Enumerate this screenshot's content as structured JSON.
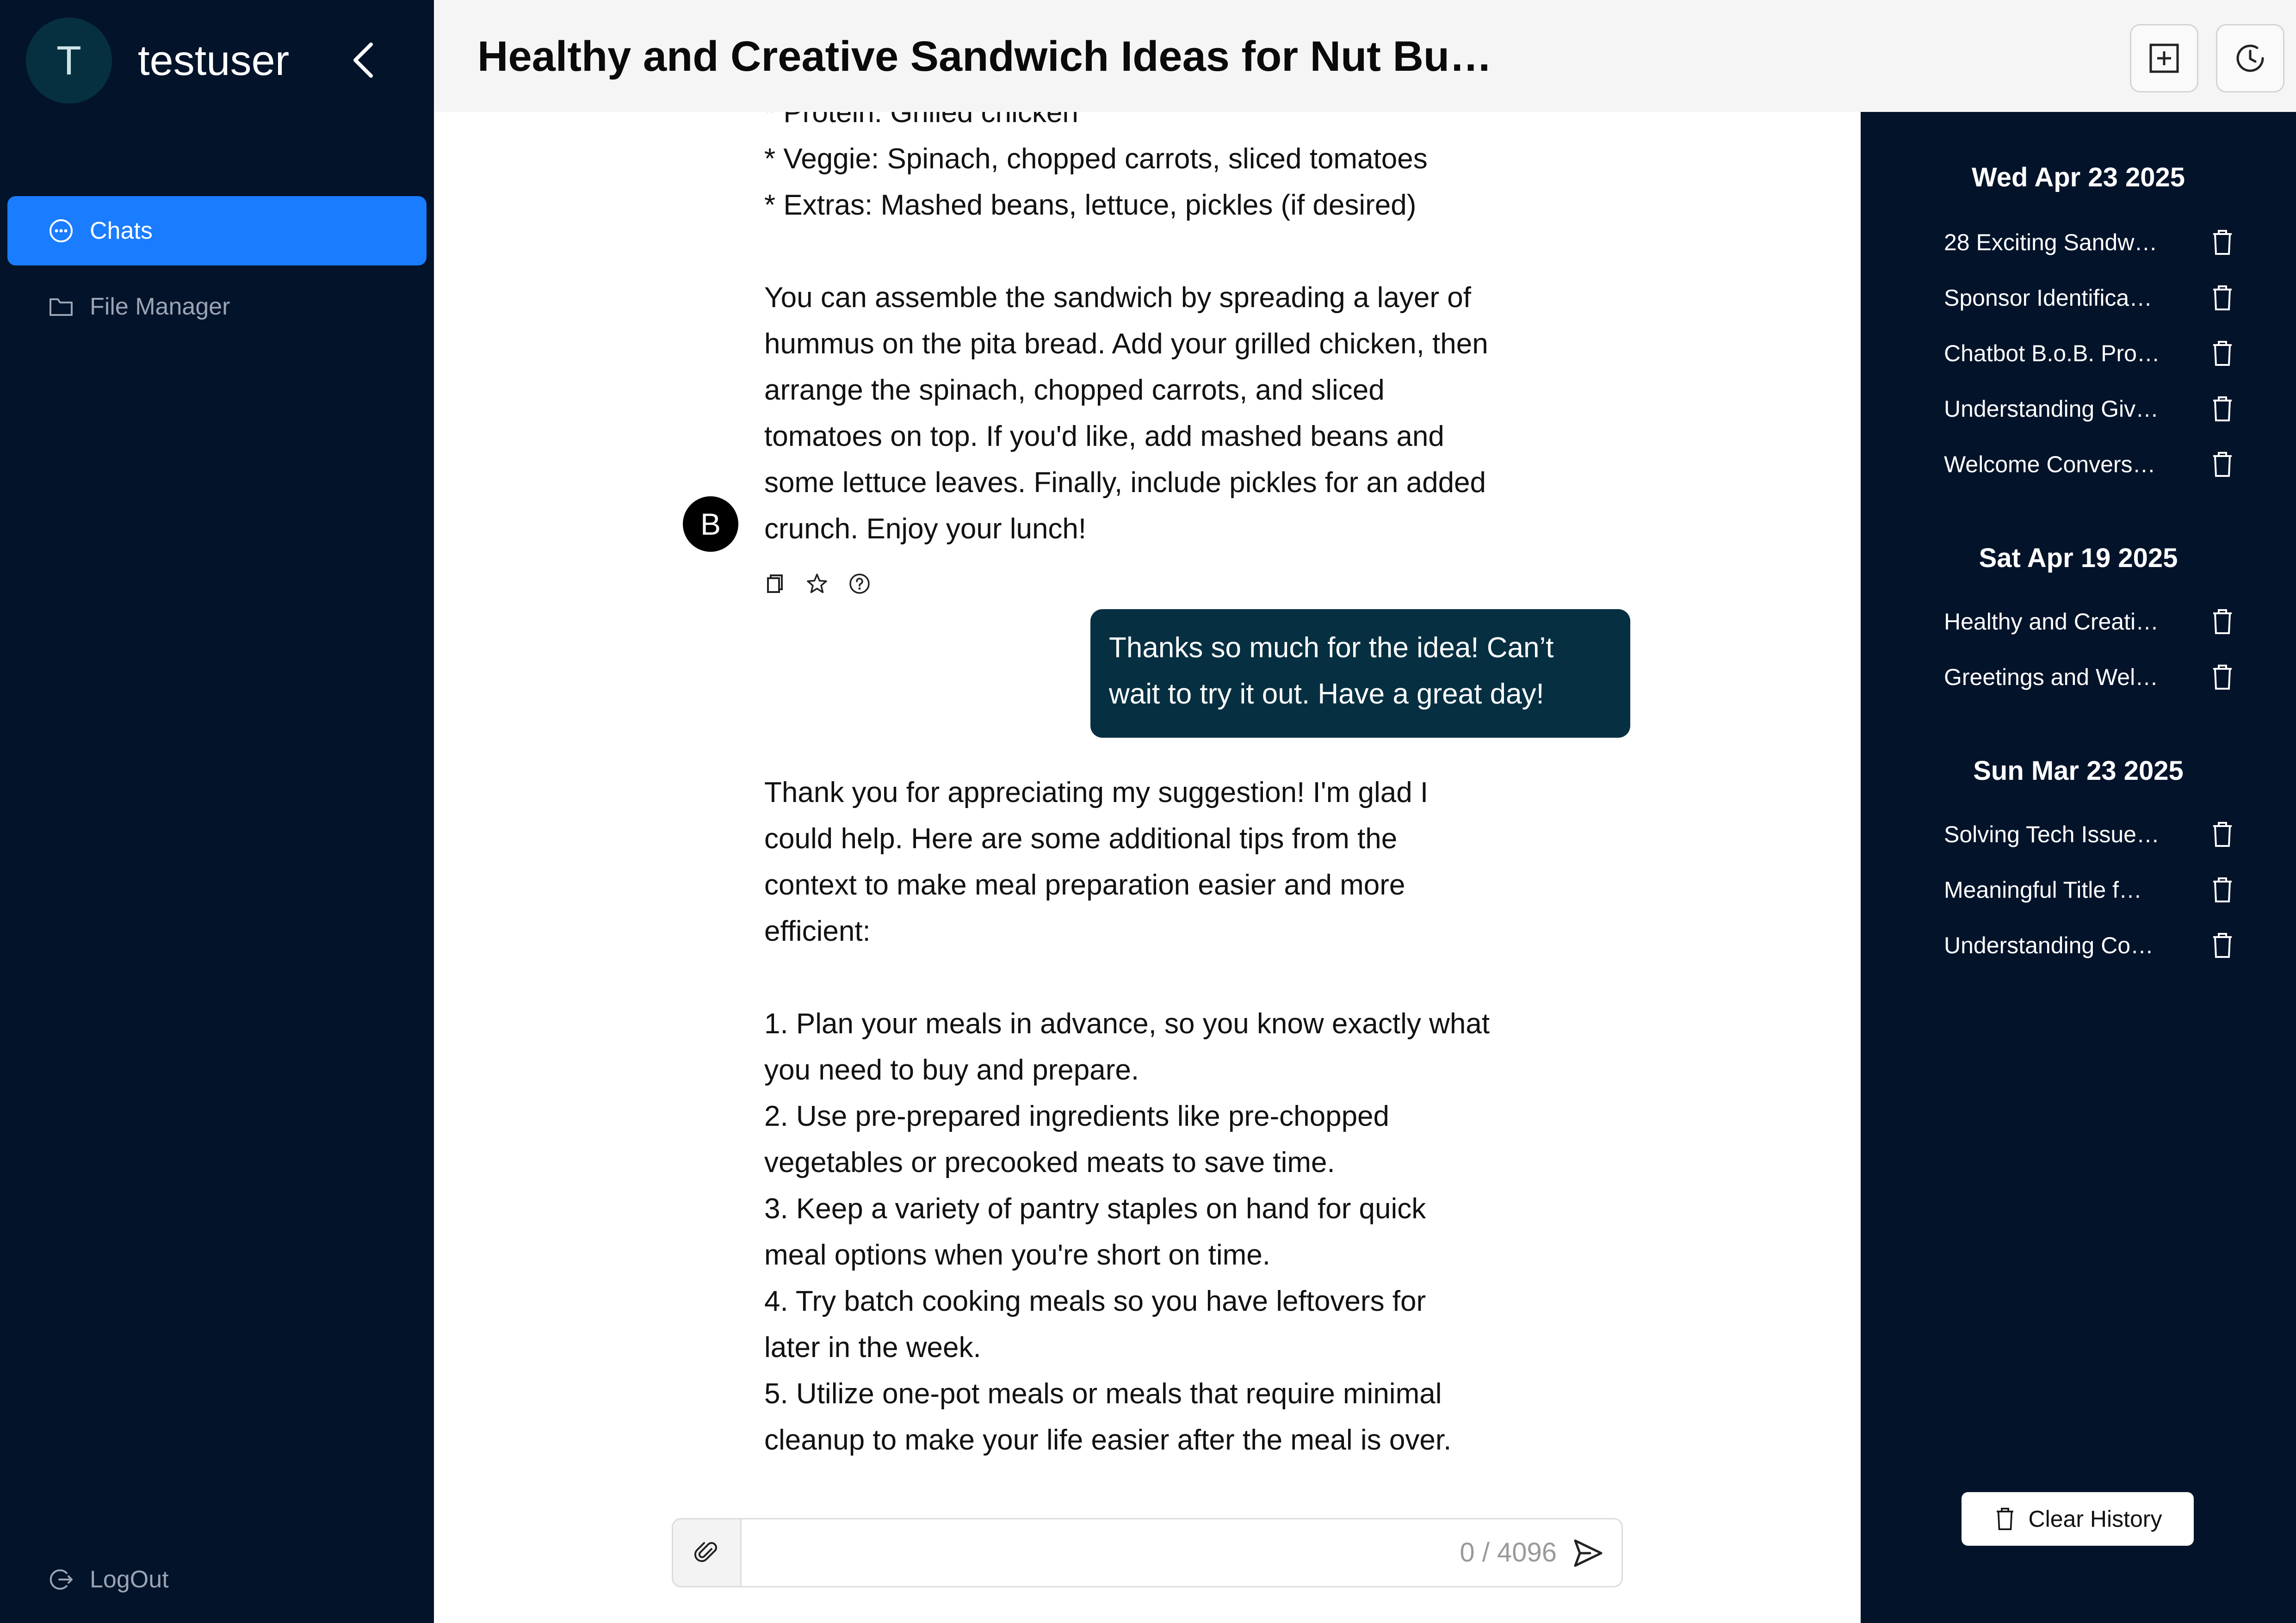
{
  "user": {
    "initial": "T",
    "name": "testuser"
  },
  "nav": {
    "chats": "Chats",
    "file_manager": "File Manager",
    "logout": "LogOut"
  },
  "header": {
    "title": "Healthy and Creative Sandwich Ideas for Nut Butte…"
  },
  "chat": {
    "message_1": "* Protein: Grilled chicken\n* Veggie: Spinach, chopped carrots, sliced tomatoes\n* Extras: Mashed beans, lettuce, pickles (if desired)\n\nYou can assemble the sandwich by spreading a layer of\nhummus on the pita bread. Add your grilled chicken, then\narrange the spinach, chopped carrots, and sliced\ntomatoes on top. If you'd like, add mashed beans and\nsome lettuce leaves. Finally, include pickles for an added\ncrunch. Enjoy your lunch!",
    "bot_initial": "B",
    "user_message": "Thanks so much for the idea! Can’t wait to try it out. Have a great day!",
    "message_2": "Thank you for appreciating my suggestion! I'm glad I\ncould help. Here are some additional tips from the\ncontext to make meal preparation easier and more\nefficient:\n\n1. Plan your meals in advance, so you know exactly what\nyou need to buy and prepare.\n2. Use pre-prepared ingredients like pre-chopped\nvegetables or precooked meats to save time.\n3. Keep a variety of pantry staples on hand for quick\nmeal options when you're short on time.\n4. Try batch cooking meals so you have leftovers for\nlater in the week.\n5. Utilize one-pot meals or meals that require minimal\ncleanup to make your life easier after the meal is over."
  },
  "input": {
    "value": "",
    "char_count": "0 / 4096"
  },
  "history": {
    "groups": [
      {
        "date": "Wed Apr 23 2025",
        "items": [
          "28 Exciting Sandw…",
          "Sponsor Identifica…",
          "Chatbot B.o.B. Pro…",
          "Understanding Giv…",
          "Welcome Convers…"
        ]
      },
      {
        "date": "Sat Apr 19 2025",
        "items": [
          "Healthy and Creati…",
          "Greetings and Wel…"
        ]
      },
      {
        "date": "Sun Mar 23 2025",
        "items": [
          "Solving Tech Issue…",
          "Meaningful Title f…",
          "Understanding Co…"
        ]
      }
    ],
    "clear_label": "Clear History"
  },
  "icons": {
    "collapse": "chevron-left-icon",
    "chats": "chat-bubble-icon",
    "files": "folder-icon",
    "logout": "logout-icon",
    "new_chat": "plus-square-icon",
    "history": "history-icon",
    "copy": "copy-icon",
    "favorite": "star-icon",
    "help": "question-circle-icon",
    "attach": "paperclip-icon",
    "send": "send-icon",
    "delete": "trash-icon"
  },
  "colors": {
    "sidebar_bg": "#03132a",
    "accent": "#1a7cff",
    "user_bubble": "#063042"
  }
}
